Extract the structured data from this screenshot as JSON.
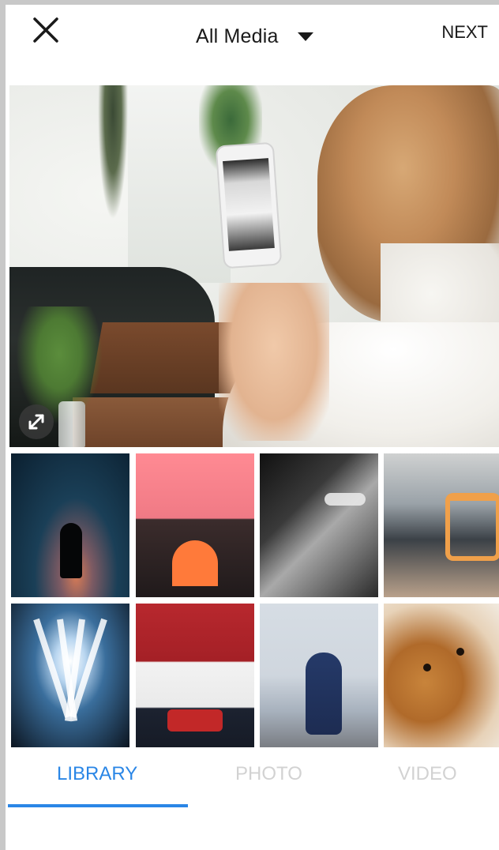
{
  "header": {
    "close_label": "Close",
    "title": "All Media",
    "next_label": "NEXT"
  },
  "preview": {
    "expand_label": "Expand"
  },
  "grid": {
    "items": [
      {
        "label": "Night silhouette"
      },
      {
        "label": "Pink sky arch"
      },
      {
        "label": "Black car"
      },
      {
        "label": "Person and chair"
      },
      {
        "label": "Concert lights"
      },
      {
        "label": "Woman in white tee"
      },
      {
        "label": "Woman in floral dress"
      },
      {
        "label": "Puppy"
      }
    ]
  },
  "tabs": [
    {
      "label": "LIBRARY"
    },
    {
      "label": "PHOTO"
    },
    {
      "label": "VIDEO"
    }
  ],
  "colors": {
    "accent_blue": "#2a86e6",
    "inactive_tab": "#d2d2d2",
    "text_dark": "#1a1a1a",
    "frame_gray": "#c8c8c8"
  },
  "icons": {
    "close": "close-icon",
    "dropdown": "chevron-down-icon",
    "expand": "expand-icon"
  }
}
